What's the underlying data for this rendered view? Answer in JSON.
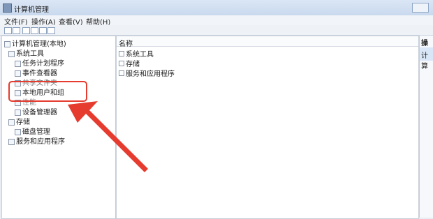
{
  "window": {
    "title": "计算机管理"
  },
  "menu": {
    "file": "文件(F)",
    "action": "操作(A)",
    "view": "查看(V)",
    "help": "帮助(H)"
  },
  "tree": {
    "root": "计算机管理(本地)",
    "system_tools": "系统工具",
    "task_scheduler": "任务计划程序",
    "event_viewer": "事件查看器",
    "shared_folders": "共享文件夹",
    "local_users": "本地用户和组",
    "performance": "性能",
    "device_manager": "设备管理器",
    "storage": "存储",
    "disk_management": "磁盘管理",
    "services": "服务和应用程序"
  },
  "center": {
    "column_name": "名称",
    "items": [
      "系统工具",
      "存储",
      "服务和应用程序"
    ]
  },
  "actions": {
    "header": "操作",
    "selected": "计算"
  },
  "colors": {
    "callout": "#e63b2f",
    "selection": "#d8e6f7"
  }
}
